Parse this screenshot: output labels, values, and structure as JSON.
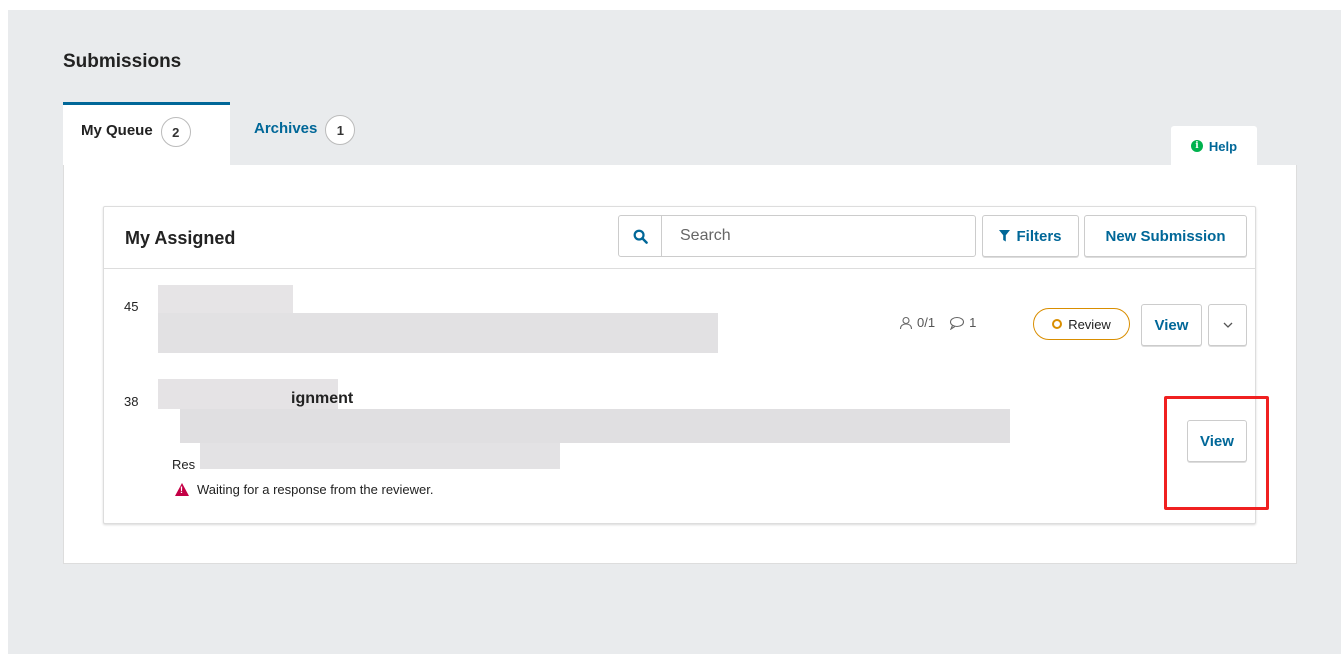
{
  "page": {
    "title": "Submissions"
  },
  "tabs": [
    {
      "label": "My Queue",
      "count": "2"
    },
    {
      "label": "Archives",
      "count": "1"
    }
  ],
  "help": {
    "label": "Help",
    "icon": "info-icon"
  },
  "list": {
    "title": "My Assigned",
    "search": {
      "placeholder": "Search",
      "icon": "search-icon"
    },
    "filters_label": "Filters",
    "new_submission_label": "New Submission",
    "items": [
      {
        "id": "45",
        "reviewers": "0/1",
        "comments": "1",
        "stage": "Review",
        "view_label": "View",
        "more_icon": "chevron-down-icon"
      },
      {
        "id": "38",
        "title_fragment": "ignment",
        "sub_fragment": "Res",
        "notice": "Waiting for a response from the reviewer.",
        "view_label": "View"
      }
    ]
  },
  "colors": {
    "accent": "#006798",
    "review_badge": "#d98e00",
    "warning": "#c40045",
    "highlight": "#f02020"
  }
}
